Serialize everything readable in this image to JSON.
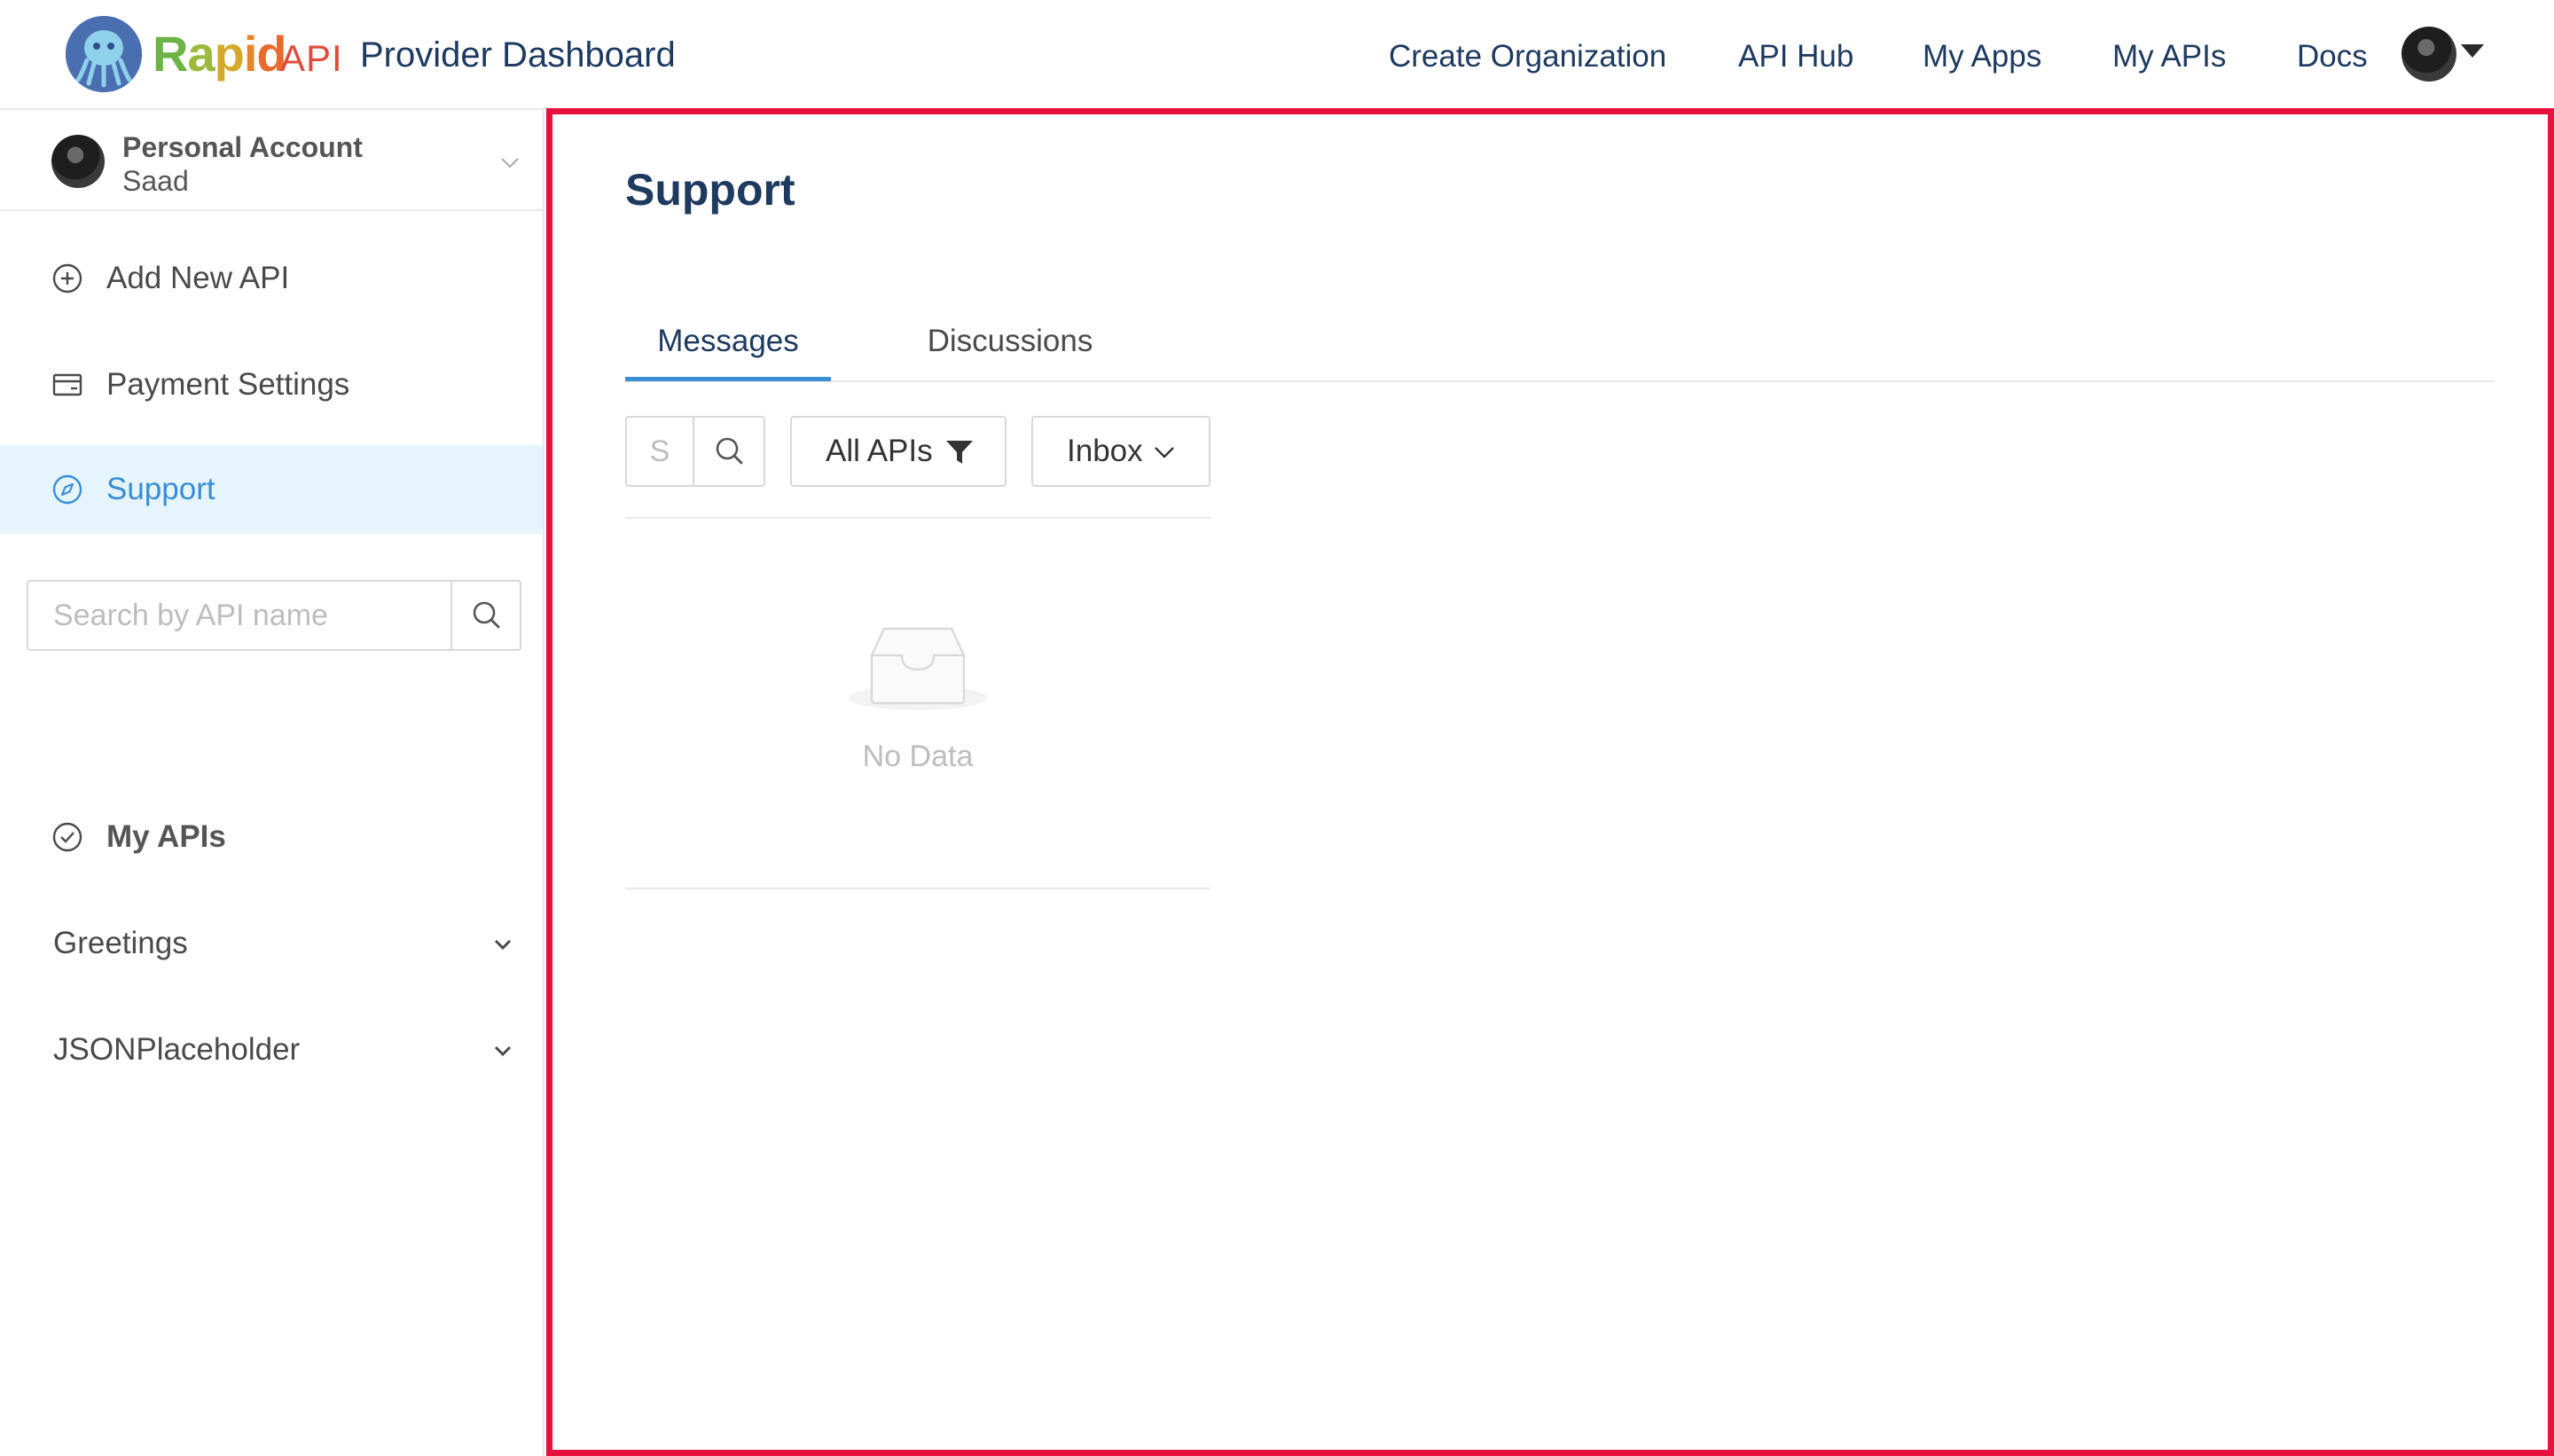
{
  "header": {
    "logo_word": "Rapid",
    "logo_suffix": "API",
    "title": "Provider Dashboard",
    "nav": [
      {
        "label": "Create Organization"
      },
      {
        "label": "API Hub"
      },
      {
        "label": "My Apps"
      },
      {
        "label": "My APIs"
      },
      {
        "label": "Docs"
      }
    ]
  },
  "sidebar": {
    "account": {
      "type": "Personal Account",
      "name": "Saad"
    },
    "items": [
      {
        "label": "Add New API",
        "icon": "plus-circle-icon"
      },
      {
        "label": "Payment Settings",
        "icon": "credit-card-icon"
      },
      {
        "label": "Support",
        "icon": "compass-icon",
        "active": true
      }
    ],
    "search": {
      "placeholder": "Search by API name"
    },
    "my_apis": {
      "label": "My APIs"
    },
    "apis": [
      {
        "label": "Greetings"
      },
      {
        "label": "JSONPlaceholder"
      }
    ]
  },
  "main": {
    "title": "Support",
    "tabs": [
      {
        "label": "Messages",
        "active": true
      },
      {
        "label": "Discussions"
      }
    ],
    "search_placeholder": "S",
    "filter_label": "All APIs",
    "folder_label": "Inbox",
    "empty_text": "No Data"
  },
  "colors": {
    "accent": "#3a8ed6",
    "nav_text": "#1e3a5f",
    "highlight_border": "#e8103c",
    "active_bg": "#e6f4fd"
  }
}
